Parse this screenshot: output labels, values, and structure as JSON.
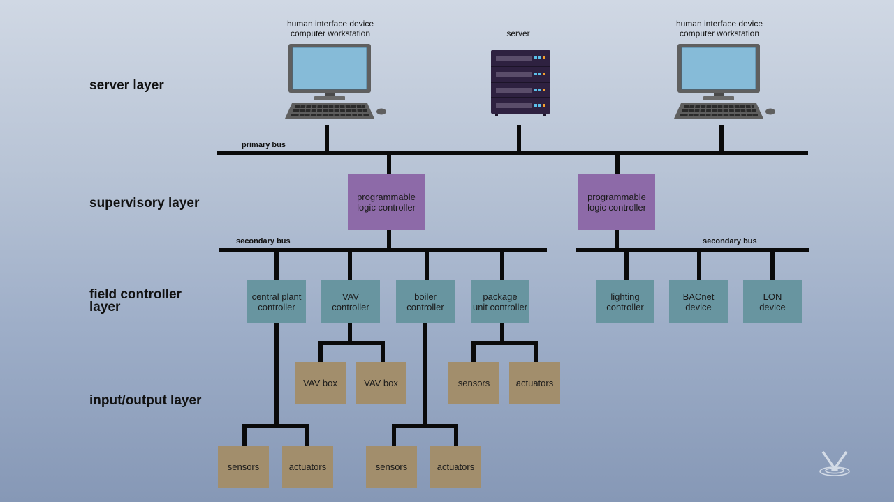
{
  "layers": {
    "server": "server layer",
    "supervisory": "supervisory layer",
    "field": "field controller\nlayer",
    "io": "input/output layer"
  },
  "buses": {
    "primary": "primary bus",
    "secondary_left": "secondary bus",
    "secondary_right": "secondary bus"
  },
  "devices": {
    "workstation_left": "human interface device\ncomputer workstation",
    "server": "server",
    "workstation_right": "human interface device\ncomputer workstation"
  },
  "plcs": [
    {
      "label": "programmable\nlogic controller"
    },
    {
      "label": "programmable\nlogic controller"
    }
  ],
  "controllers": [
    {
      "label": "central plant\ncontroller"
    },
    {
      "label": "VAV\ncontroller"
    },
    {
      "label": "boiler\ncontroller"
    },
    {
      "label": "package\nunit controller"
    },
    {
      "label": "lighting\ncontroller"
    },
    {
      "label": "BACnet\ndevice"
    },
    {
      "label": "LON\ndevice"
    }
  ],
  "io_boxes": [
    {
      "label": "VAV box"
    },
    {
      "label": "VAV box"
    },
    {
      "label": "sensors"
    },
    {
      "label": "actuators"
    },
    {
      "label": "sensors"
    },
    {
      "label": "actuators"
    },
    {
      "label": "sensors"
    },
    {
      "label": "actuators"
    }
  ],
  "colors": {
    "plc": "#8d6aa8",
    "controller": "#6895a0",
    "io": "#a28e6c",
    "bus": "#0a0a0a",
    "screen": "#86bbd8",
    "server_body": "#2e2140"
  },
  "logo": "v-logo-icon"
}
